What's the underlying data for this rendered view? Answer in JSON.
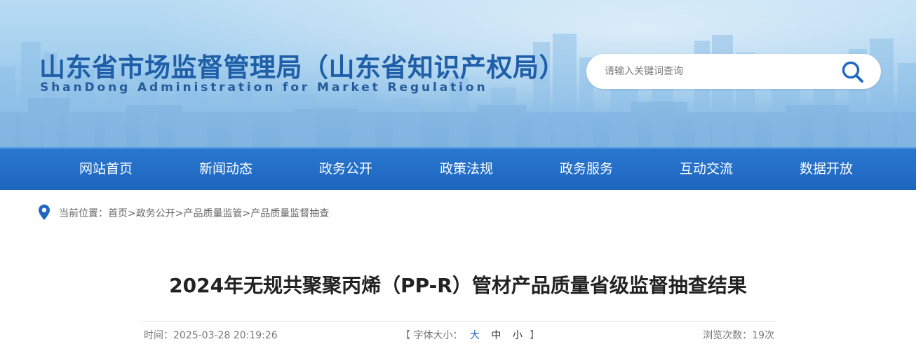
{
  "header": {
    "title": "山东省市场监督管理局（山东省知识产权局）",
    "subtitle": "ShanDong Administration for Market Regulation",
    "search": {
      "placeholder": "请输入关键词查询"
    }
  },
  "nav": {
    "items": [
      "网站首页",
      "新闻动态",
      "政务公开",
      "政策法规",
      "政务服务",
      "互动交流",
      "数据开放"
    ]
  },
  "breadcrumb": {
    "prefix": "当前位置：",
    "items": [
      "首页",
      "政务公开",
      "产品质量监管",
      "产品质量监督抽查"
    ],
    "separator": ">"
  },
  "article": {
    "title": "2024年无规共聚聚丙烯（PP-R）管材产品质量省级监督抽查结果",
    "time_label": "时间：2025-03-28 20:19:26",
    "font_size_open": "【 字体大小：",
    "font_sizes": [
      "大",
      "中",
      "小"
    ],
    "font_size_close": "】",
    "views_label": "浏览次数：19次"
  },
  "colors": {
    "nav_bg": "#1f69c3",
    "title_blue": "#1f5ea8",
    "active_font_size": "#1a64c4"
  }
}
